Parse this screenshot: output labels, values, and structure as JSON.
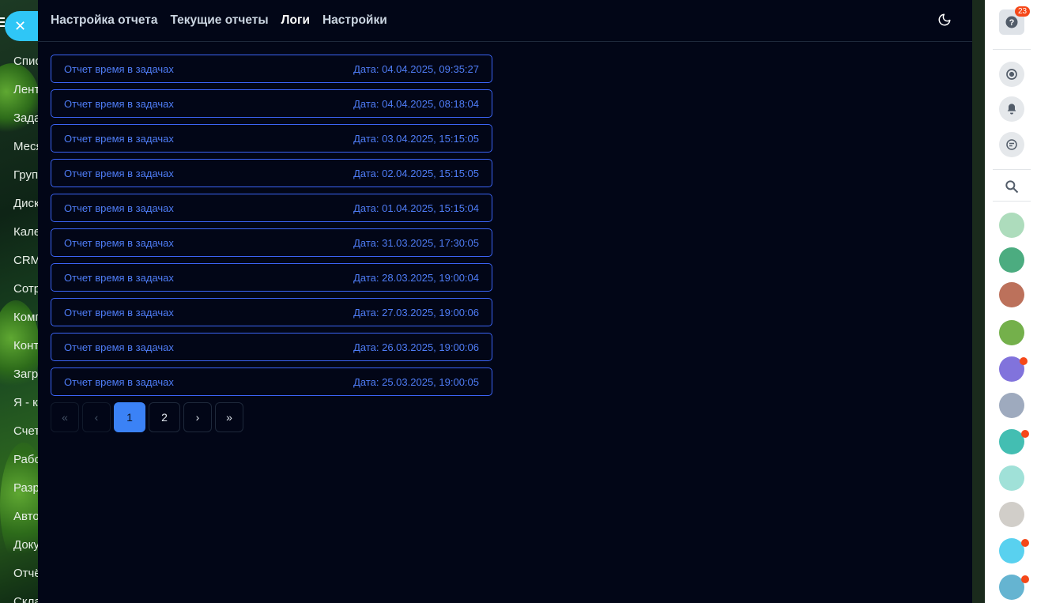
{
  "background_menu": {
    "items": [
      "Спис",
      "Лент",
      "Зада",
      "Меся",
      "Груп",
      "Диск",
      "Кале",
      "CRM",
      "Сотр",
      "Комп",
      "Конт",
      "Загр",
      "Я - к",
      "Счет",
      "Рабо",
      "Разр",
      "Авто",
      "Доку",
      "Отчё",
      "Скла"
    ]
  },
  "close_glyph": "✕",
  "nav": {
    "tabs": [
      {
        "label": "Настройка отчета",
        "active": false
      },
      {
        "label": "Текущие отчеты",
        "active": false
      },
      {
        "label": "Логи",
        "active": true
      },
      {
        "label": "Настройки",
        "active": false
      }
    ],
    "theme_icon": "moon-icon"
  },
  "logs": [
    {
      "title": "Отчет время в задачах",
      "date": "Дата: 04.04.2025, 09:35:27"
    },
    {
      "title": "Отчет время в задачах",
      "date": "Дата: 04.04.2025, 08:18:04"
    },
    {
      "title": "Отчет время в задачах",
      "date": "Дата: 03.04.2025, 15:15:05"
    },
    {
      "title": "Отчет время в задачах",
      "date": "Дата: 02.04.2025, 15:15:05"
    },
    {
      "title": "Отчет время в задачах",
      "date": "Дата: 01.04.2025, 15:15:04"
    },
    {
      "title": "Отчет время в задачах",
      "date": "Дата: 31.03.2025, 17:30:05"
    },
    {
      "title": "Отчет время в задачах",
      "date": "Дата: 28.03.2025, 19:00:04"
    },
    {
      "title": "Отчет время в задачах",
      "date": "Дата: 27.03.2025, 19:00:06"
    },
    {
      "title": "Отчет время в задачах",
      "date": "Дата: 26.03.2025, 19:00:06"
    },
    {
      "title": "Отчет время в задачах",
      "date": "Дата: 25.03.2025, 19:00:05"
    }
  ],
  "pagination": {
    "first": "«",
    "prev": "‹",
    "pages": [
      "1",
      "2"
    ],
    "current": "1",
    "next": "›",
    "last": "»"
  },
  "right_sidebar": {
    "help_badge": "23",
    "colors": {
      "accent": "#2fc6f6",
      "link": "#4f7df7",
      "active_page": "#3b82f6",
      "badge": "#f54819"
    }
  }
}
